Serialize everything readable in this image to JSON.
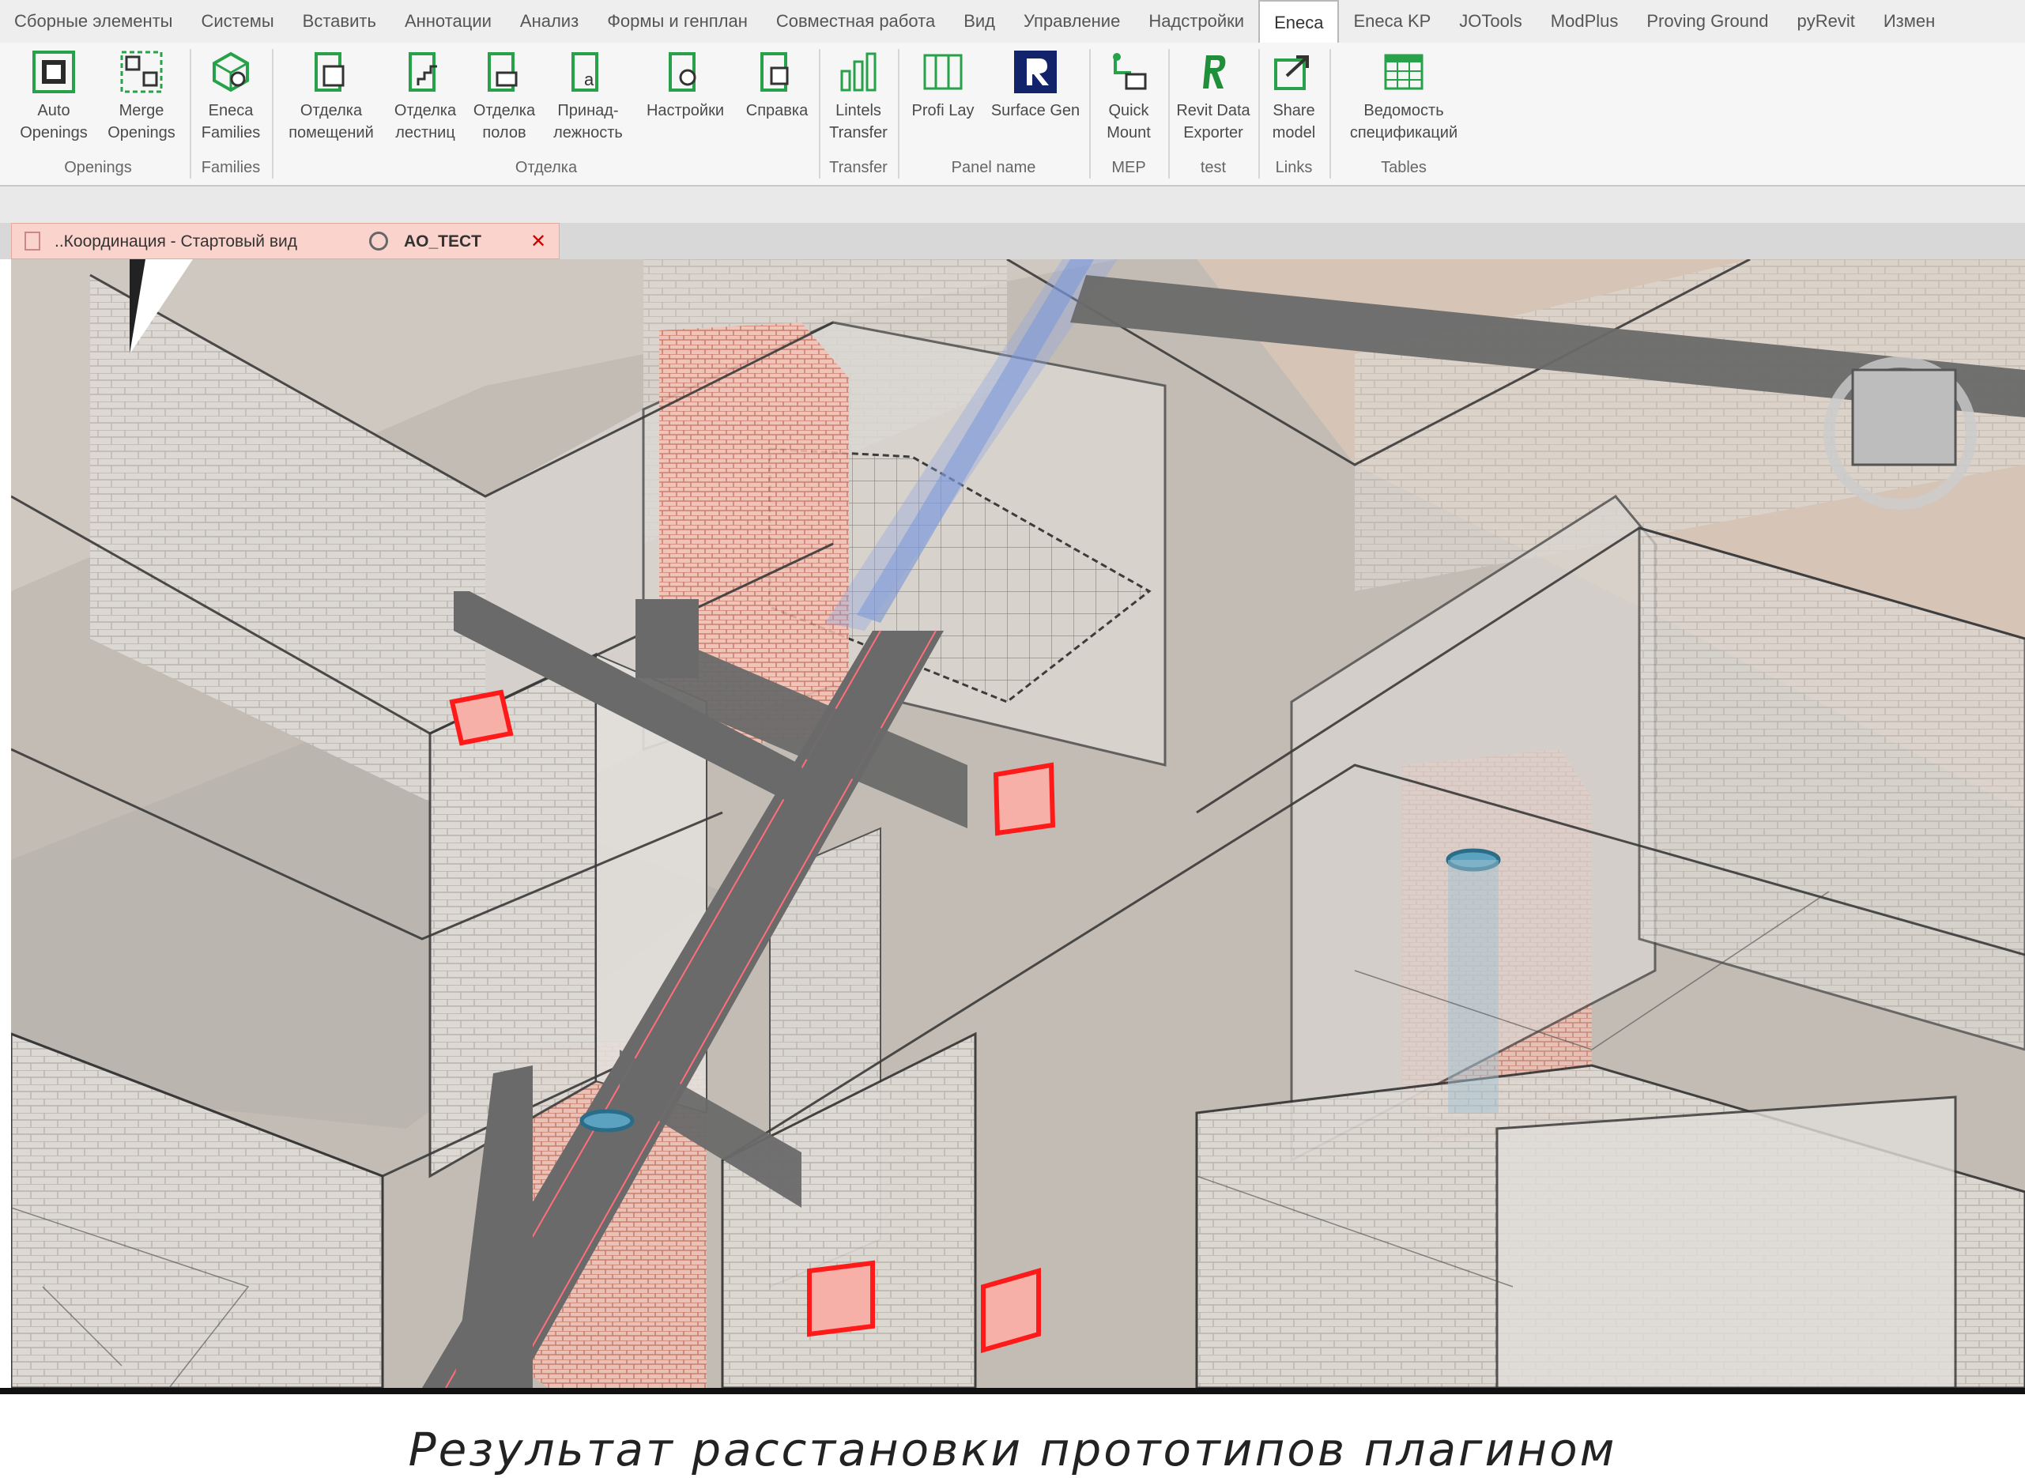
{
  "menu": {
    "tabs": [
      "Сборные элементы",
      "Системы",
      "Вставить",
      "Аннотации",
      "Анализ",
      "Формы и генплан",
      "Совместная работа",
      "Вид",
      "Управление",
      "Надстройки",
      "Eneca",
      "Eneca KP",
      "JOTools",
      "ModPlus",
      "Proving Ground",
      "pyRevit",
      "Измен"
    ],
    "active": "Eneca"
  },
  "ribbon": {
    "auto_openings": {
      "l1": "Auto",
      "l2": "Openings"
    },
    "merge_openings": {
      "l1": "Merge",
      "l2": "Openings"
    },
    "eneca_families": {
      "l1": "Eneca",
      "l2": "Families"
    },
    "finish_rooms": {
      "l1": "Отделка",
      "l2": "помещений"
    },
    "finish_stairs": {
      "l1": "Отделка",
      "l2": "лестниц"
    },
    "finish_floors": {
      "l1": "Отделка",
      "l2": "полов"
    },
    "belonging": {
      "l1": "Принад-",
      "l2": "лежность"
    },
    "settings": {
      "l1": "Настройки"
    },
    "help": {
      "l1": "Справка"
    },
    "lintels_transfer": {
      "l1": "Lintels",
      "l2": "Transfer"
    },
    "profi_lay": {
      "l1": "Profi Lay"
    },
    "surface_gen": {
      "l1": "Surface Gen"
    },
    "quick_mount": {
      "l1": "Quick",
      "l2": "Mount"
    },
    "revit_data_exporter": {
      "l1": "Revit Data",
      "l2": "Exporter"
    },
    "share_model": {
      "l1": "Share",
      "l2": "model"
    },
    "spec_sheets": {
      "l1": "Ведомость",
      "l2": "спецификаций"
    },
    "groups": {
      "openings": "Openings",
      "families": "Families",
      "finish": "Отделка",
      "transfer": "Transfer",
      "panel_name": "Panel name",
      "mep": "MEP",
      "test": "test",
      "links": "Links",
      "tables": "Tables"
    }
  },
  "view_tab": {
    "title": "..Координация - Стартовый вид",
    "name": "AO_TECT",
    "close": "✕"
  },
  "caption": "Результат расстановки прототипов плагином",
  "colors": {
    "accent_green": "#27a24a",
    "tab_pink": "#fbd3cd",
    "duct_gray": "#6a6a6a",
    "opening_red": "#ff2a2a",
    "duct_blue": "#7e9ad8"
  }
}
